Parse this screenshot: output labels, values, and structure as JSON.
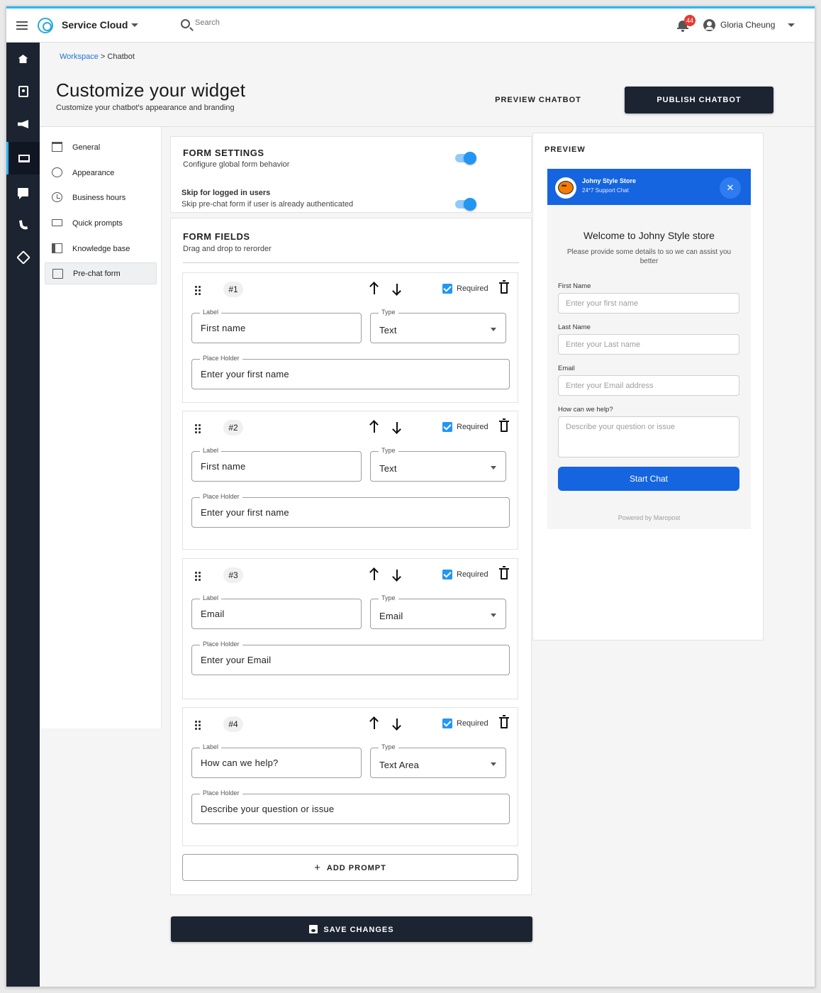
{
  "app": {
    "name": "Service Cloud",
    "search_placeholder": "Search",
    "notification_count": "44",
    "user_name": "Gloria Cheung"
  },
  "sidebar": {
    "items": [
      {
        "icon": "home-icon"
      },
      {
        "icon": "contacts-icon"
      },
      {
        "icon": "campaign-icon"
      },
      {
        "icon": "laptop-icon",
        "active": true
      },
      {
        "icon": "chat-icon"
      },
      {
        "icon": "phone-icon"
      },
      {
        "icon": "puzzle-icon"
      }
    ]
  },
  "breadcrumb": {
    "root": "Workspace",
    "separator": ">",
    "current": "Chatbot"
  },
  "page": {
    "title": "Customize your widget",
    "subtitle": "Customize your chatbot's appearance and branding",
    "preview_button": "PREVIEW CHATBOT",
    "publish_button": "PUBLISH CHATBOT"
  },
  "submenu": {
    "items": [
      {
        "label": "General",
        "icon": "building-icon"
      },
      {
        "label": "Appearance",
        "icon": "palette-icon"
      },
      {
        "label": "Business hours",
        "icon": "clock-icon"
      },
      {
        "label": "Quick prompts",
        "icon": "quick-prompt-icon"
      },
      {
        "label": "Knowledge base",
        "icon": "book-icon"
      },
      {
        "label": "Pre-chat form",
        "icon": "form-icon",
        "selected": true
      }
    ]
  },
  "form_settings": {
    "title": "FORM SETTINGS",
    "subtitle": "Configure global form behavior",
    "enabled": true,
    "skip_title": "Skip for logged in users",
    "skip_desc": "Skip pre-chat form if user is already authenticated",
    "skip_enabled": true
  },
  "form_fields": {
    "title": "FORM FIELDS",
    "subtitle": "Drag and drop to rerorder",
    "label_caption": "Label",
    "type_caption": "Type",
    "placeholder_caption": "Place Holder",
    "required_caption": "Required",
    "fields": [
      {
        "index": "#1",
        "label": "First name",
        "type": "Text",
        "placeholder": "Enter your first name",
        "required": true
      },
      {
        "index": "#2",
        "label": "First name",
        "type": "Text",
        "placeholder": "Enter your first name",
        "required": true
      },
      {
        "index": "#3",
        "label": "Email",
        "type": "Email",
        "placeholder": "Enter your Email",
        "required": true
      },
      {
        "index": "#4",
        "label": "How can we help?",
        "type": "Text Area",
        "placeholder": "Describe your question or issue",
        "required": true
      }
    ],
    "add_button": "ADD PROMPT"
  },
  "save_button": "SAVE CHANGES",
  "preview": {
    "title": "PREVIEW",
    "store_name": "Johny Style Store",
    "support_label": "24*7 Support Chat",
    "welcome": "Welcome to Johny Style store",
    "description": "Please provide some details to so we can assist you better",
    "fields": [
      {
        "label": "First Name",
        "placeholder": "Enter your first name"
      },
      {
        "label": "Last Name",
        "placeholder": "Enter your Last name"
      },
      {
        "label": "Email",
        "placeholder": "Enter your Email address"
      },
      {
        "label": "How can we help?",
        "placeholder": "Describe your question or issue"
      }
    ],
    "start_button": "Start Chat",
    "powered_by": "Powered by Maropost"
  },
  "colors": {
    "accent": "#29b6f6",
    "sidebar_bg": "#1c2331",
    "primary_button": "#1c2331",
    "widget_blue": "#1565e0",
    "toggle_on": "#2196f3"
  }
}
